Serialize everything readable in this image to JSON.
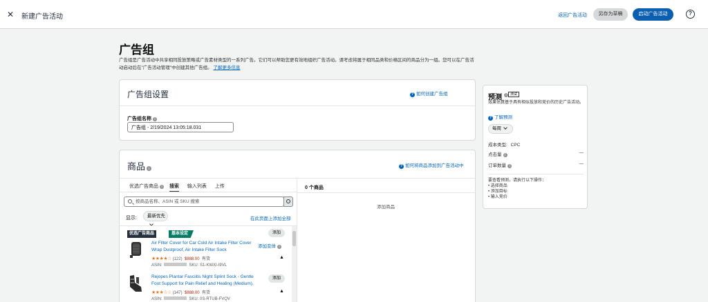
{
  "header": {
    "page_title": "新建广告活动",
    "back_link": "返回广告活动",
    "save_draft": "另存为草稿",
    "launch": "启动广告活动",
    "help_glyph": "?"
  },
  "ad_group": {
    "heading": "广告组",
    "intro": "广告组是广告活动中共享相同投放策略或广告素材类型的一系列广告。它们可以帮助您更有效地组织广告活动。请考虑将属于相同品类和价格区间的商品分为一组。您可以在广告活动启动后在\"广告活动管理\"中创建其他广告组。",
    "learn_more": "了解更多信息"
  },
  "settings_card": {
    "title": "广告组设置",
    "how_link": "如何创建广告组",
    "name_label": "广告组名称",
    "name_value": "广告组 - 2/19/2024 13:05:18.031"
  },
  "products_card": {
    "title": "商品",
    "how_link": "如何将商品添加到广告活动中",
    "tabs": [
      "优选广告商品",
      "搜索",
      "输入列表",
      "上传"
    ],
    "search_placeholder": "按商品名称、ASIN 或 SKU 搜索",
    "display_label": "显示:",
    "sort_value": "最新优先",
    "add_all": "在此页面上添加全部",
    "selected_count": "0 个商品",
    "empty_text": "添加商品",
    "items": [
      {
        "badge_primary": "优选广告商品",
        "badge_secondary": "基本设定",
        "add_label": "添加",
        "name": "Air Filter Cover for Car Cold Air Intake Filter Cover Wrap Dustproof, Air Intake Filter Sock",
        "add_creative": "添加变体",
        "stars": "★★★★☆",
        "reviews": "(122)",
        "price": "$888.00",
        "stock": "有货",
        "asin_label": "ASIN:",
        "sku": "SKU: S1-KWXI-I9VL"
      },
      {
        "add_label": "添加",
        "name": "Rejopes Plantar Fasciitis Night Splint Sock - Gentle Foot Support for Pain Relief and Healing (Medium),",
        "stars": "★★★☆☆",
        "reviews": "(147)",
        "price": "$888.00",
        "stock": "有货",
        "asin_label": "ASIN:",
        "sku": "SKU: 0S-RTUB-FVQV"
      }
    ]
  },
  "forecast": {
    "title": "预测",
    "beta": "测试",
    "desc": "效果估算基于具有相似投放和竞价的历史广告活动。",
    "learn": "了解预测",
    "period": "每周",
    "cost_type_label": "成本类型:",
    "cost_type_value": "CPC",
    "impressions_label": "点击量",
    "impressions_value": "—",
    "orders_label": "订单数量",
    "orders_value": "—",
    "req_title": "要查看预测，请执行以下操作：",
    "req_items": [
      "选择商品",
      "添加目标",
      "输入竞价"
    ]
  },
  "colors": {
    "primary_button": "#0b5fb0",
    "link": "#0066c0",
    "badge_dark": "#232f3e",
    "badge_green": "#067d62",
    "star": "#de7921"
  }
}
